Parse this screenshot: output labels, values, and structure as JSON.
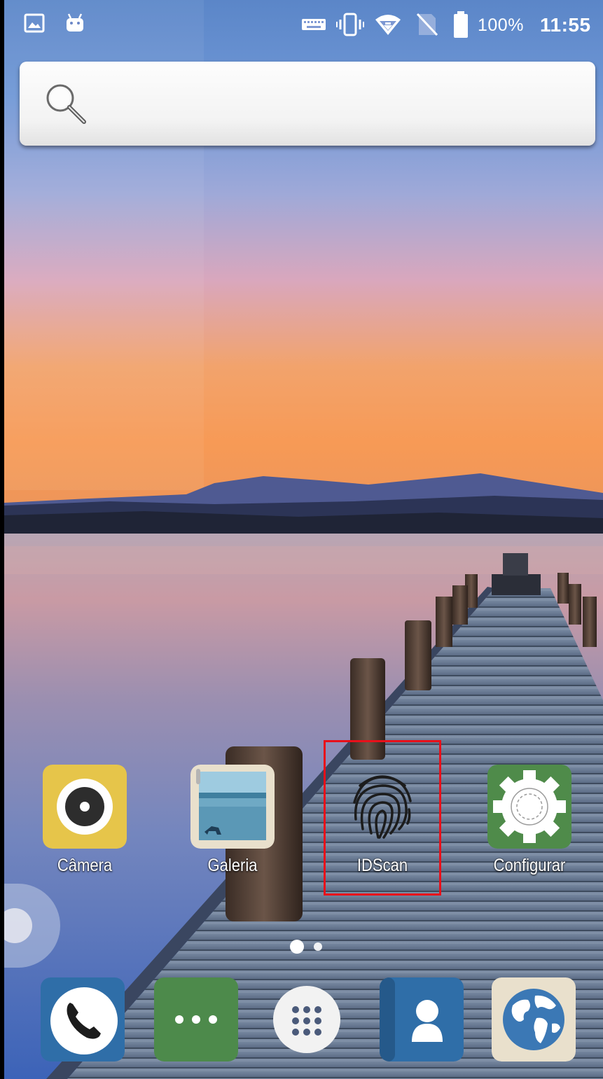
{
  "status_bar": {
    "battery_percent": "100%",
    "time": "11:55",
    "icons": [
      "gallery-notification-icon",
      "android-icon",
      "keyboard-icon",
      "vibrate-icon",
      "wifi-icon",
      "no-sim-icon",
      "battery-icon"
    ]
  },
  "search": {
    "icon": "search-icon",
    "placeholder": ""
  },
  "home_apps": [
    {
      "label": "Câmera",
      "icon": "camera-icon",
      "color": "#e6c54a"
    },
    {
      "label": "Galeria",
      "icon": "gallery-icon",
      "color": "#e9e0cc"
    },
    {
      "label": "IDScan",
      "icon": "fingerprint-icon",
      "color": "transparent"
    },
    {
      "label": "Configurar",
      "icon": "settings-gear-icon",
      "color": "#4f8b4a"
    }
  ],
  "highlight_color": "#e8101a",
  "pager": {
    "pages": 2,
    "current": 1
  },
  "dock": [
    {
      "icon": "phone-icon",
      "color": "#2f6ea8"
    },
    {
      "icon": "messages-icon",
      "color": "#4d8a4b"
    },
    {
      "icon": "app-drawer-icon",
      "color": "#f2f2f2"
    },
    {
      "icon": "contacts-icon",
      "color": "#2f6ea8"
    },
    {
      "icon": "browser-globe-icon",
      "color": "#e9e0cc"
    }
  ]
}
